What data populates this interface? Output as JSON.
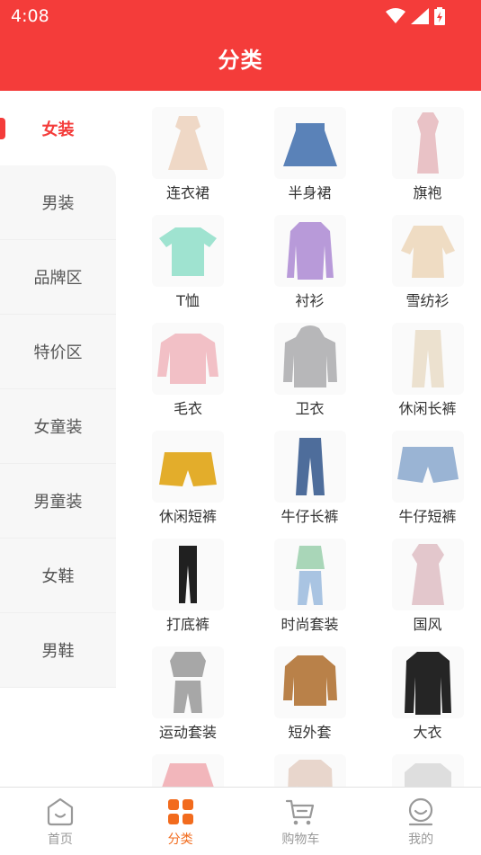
{
  "status_bar": {
    "time": "4:08",
    "icons": [
      "wifi-icon",
      "signal-icon",
      "battery-icon"
    ]
  },
  "header": {
    "title": "分类"
  },
  "colors": {
    "brand_red": "#f43c3a",
    "tab_active": "#f26b1d"
  },
  "sidebar": {
    "items": [
      {
        "label": "女装",
        "active": true
      },
      {
        "label": "男装"
      },
      {
        "label": "品牌区"
      },
      {
        "label": "特价区"
      },
      {
        "label": "女童装"
      },
      {
        "label": "男童装"
      },
      {
        "label": "女鞋"
      },
      {
        "label": "男鞋"
      }
    ]
  },
  "categories": [
    {
      "label": "连衣裙",
      "icon": "dress-icon",
      "color": "#efd8c6"
    },
    {
      "label": "半身裙",
      "icon": "skirt-icon",
      "color": "#5a82b8"
    },
    {
      "label": "旗袍",
      "icon": "qipao-icon",
      "color": "#e9c2c6"
    },
    {
      "label": "T恤",
      "icon": "tshirt-icon",
      "color": "#9fe3d0"
    },
    {
      "label": "衬衫",
      "icon": "shirt-icon",
      "color": "#b89ad9"
    },
    {
      "label": "雪纺衫",
      "icon": "blouse-icon",
      "color": "#efdcc3"
    },
    {
      "label": "毛衣",
      "icon": "sweater-icon",
      "color": "#f2c0c6"
    },
    {
      "label": "卫衣",
      "icon": "hoodie-icon",
      "color": "#b7b7b9"
    },
    {
      "label": "休闲长裤",
      "icon": "pants-icon",
      "color": "#ece1cf"
    },
    {
      "label": "休闲短裤",
      "icon": "shorts-icon",
      "color": "#e3ad2b"
    },
    {
      "label": "牛仔长裤",
      "icon": "jeans-icon",
      "color": "#4e6d9b"
    },
    {
      "label": "牛仔短裤",
      "icon": "denim-shorts-icon",
      "color": "#9ab4d4"
    },
    {
      "label": "打底裤",
      "icon": "leggings-icon",
      "color": "#202020"
    },
    {
      "label": "时尚套装",
      "icon": "outfit-icon",
      "color": "#a9d6b8"
    },
    {
      "label": "国风",
      "icon": "hanfu-icon",
      "color": "#e3c7cc"
    },
    {
      "label": "运动套装",
      "icon": "tracksuit-icon",
      "color": "#a7a7a7"
    },
    {
      "label": "短外套",
      "icon": "jacket-icon",
      "color": "#b98149"
    },
    {
      "label": "大衣",
      "icon": "coat-icon",
      "color": "#252525"
    },
    {
      "label": "",
      "icon": "puffer-icon",
      "color": "#f2b6bb"
    },
    {
      "label": "",
      "icon": "coat-icon",
      "color": "#e8d6cc"
    },
    {
      "label": "",
      "icon": "blazer-icon",
      "color": "#dedede"
    }
  ],
  "tabbar": {
    "tabs": [
      {
        "label": "首页",
        "icon": "home-icon"
      },
      {
        "label": "分类",
        "icon": "category-icon",
        "active": true
      },
      {
        "label": "购物车",
        "icon": "cart-icon"
      },
      {
        "label": "我的",
        "icon": "profile-icon"
      }
    ]
  }
}
